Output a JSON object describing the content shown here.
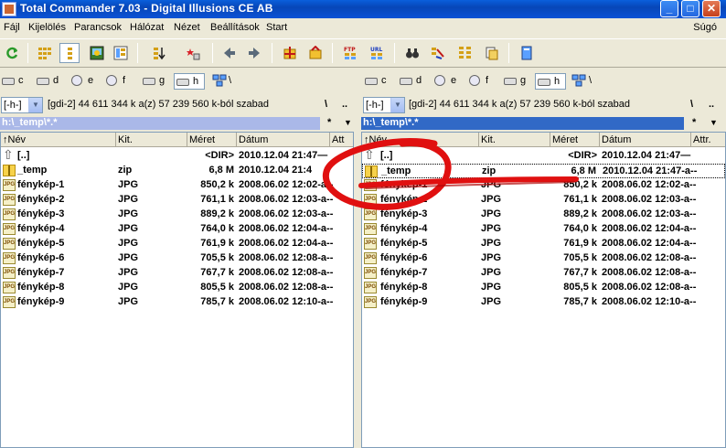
{
  "window": {
    "title": "Total Commander 7.03 - Digital Illusions CE AB",
    "minimize": "_",
    "maximize": "□",
    "close": "✕"
  },
  "menu": {
    "items": [
      "Fájl",
      "Kijelölés",
      "Parancsok",
      "Hálózat",
      "Nézet",
      "Beállítások",
      "Start"
    ],
    "help": "Súgó"
  },
  "toolbar": {
    "buttons": [
      "refresh-icon",
      "icons-view-icon",
      "detail-view-icon",
      "thumbnail-view-icon",
      "tree-view-icon",
      "sort-icon",
      "star-icon",
      "back-icon",
      "forward-icon",
      "pack-icon",
      "unpack-icon",
      "ftp-connect-icon",
      "url-connect-icon",
      "find-icon",
      "rename-icon",
      "sync-icon",
      "compare-icon",
      "notepad-icon"
    ],
    "ftp_label": "FTP",
    "url_label": "URL"
  },
  "drives": [
    "c",
    "d",
    "e",
    "f",
    "g",
    "h"
  ],
  "net_label": "\\",
  "left": {
    "combo": "[-h-]",
    "free": "[gdi-2]  44 611 344 k a(z) 57 239 560 k-ból szabad",
    "root": "\\",
    "dotdot": "..",
    "path": "h:\\_temp\\*.*",
    "star": "*",
    "columns": [
      "↑Név",
      "Kit.",
      "Méret",
      "Dátum",
      "Att"
    ],
    "rows": [
      {
        "name": "[..]",
        "ext": "",
        "size": "<DIR>",
        "date": "2010.12.04 21:47—",
        "icon": "up"
      },
      {
        "name": "_temp",
        "ext": "zip",
        "size": "6,8 M",
        "date": "2010.12.04 21:4",
        "icon": "zip"
      },
      {
        "name": "fénykép-1",
        "ext": "JPG",
        "size": "850,2 k",
        "date": "2008.06.02 12:02-a--",
        "icon": "jpg"
      },
      {
        "name": "fénykép-2",
        "ext": "JPG",
        "size": "761,1 k",
        "date": "2008.06.02 12:03-a--",
        "icon": "jpg"
      },
      {
        "name": "fénykép-3",
        "ext": "JPG",
        "size": "889,2 k",
        "date": "2008.06.02 12:03-a--",
        "icon": "jpg"
      },
      {
        "name": "fénykép-4",
        "ext": "JPG",
        "size": "764,0 k",
        "date": "2008.06.02 12:04-a--",
        "icon": "jpg"
      },
      {
        "name": "fénykép-5",
        "ext": "JPG",
        "size": "761,9 k",
        "date": "2008.06.02 12:04-a--",
        "icon": "jpg"
      },
      {
        "name": "fénykép-6",
        "ext": "JPG",
        "size": "705,5 k",
        "date": "2008.06.02 12:08-a--",
        "icon": "jpg"
      },
      {
        "name": "fénykép-7",
        "ext": "JPG",
        "size": "767,7 k",
        "date": "2008.06.02 12:08-a--",
        "icon": "jpg"
      },
      {
        "name": "fénykép-8",
        "ext": "JPG",
        "size": "805,5 k",
        "date": "2008.06.02 12:08-a--",
        "icon": "jpg"
      },
      {
        "name": "fénykép-9",
        "ext": "JPG",
        "size": "785,7 k",
        "date": "2008.06.02 12:10-a--",
        "icon": "jpg"
      }
    ]
  },
  "right": {
    "combo": "[-h-]",
    "free": "[gdi-2]  44 611 344 k a(z) 57 239 560 k-ból szabad",
    "root": "\\",
    "dotdot": "..",
    "path": "h:\\_temp\\*.*",
    "star": "*",
    "columns": [
      "↑Név",
      "Kit.",
      "Méret",
      "Dátum",
      "Attr."
    ],
    "rows": [
      {
        "name": "[..]",
        "ext": "",
        "size": "<DIR>",
        "date": "2010.12.04 21:47—",
        "icon": "up"
      },
      {
        "name": "_temp",
        "ext": "zip",
        "size": "6,8 M",
        "date": "2010.12.04 21:47-a--",
        "icon": "zip"
      },
      {
        "name": "fénykép-1",
        "ext": "JPG",
        "size": "850,2 k",
        "date": "2008.06.02 12:02-a--",
        "icon": "jpg"
      },
      {
        "name": "fénykép-2",
        "ext": "JPG",
        "size": "761,1 k",
        "date": "2008.06.02 12:03-a--",
        "icon": "jpg"
      },
      {
        "name": "fénykép-3",
        "ext": "JPG",
        "size": "889,2 k",
        "date": "2008.06.02 12:03-a--",
        "icon": "jpg"
      },
      {
        "name": "fénykép-4",
        "ext": "JPG",
        "size": "764,0 k",
        "date": "2008.06.02 12:04-a--",
        "icon": "jpg"
      },
      {
        "name": "fénykép-5",
        "ext": "JPG",
        "size": "761,9 k",
        "date": "2008.06.02 12:04-a--",
        "icon": "jpg"
      },
      {
        "name": "fénykép-6",
        "ext": "JPG",
        "size": "705,5 k",
        "date": "2008.06.02 12:08-a--",
        "icon": "jpg"
      },
      {
        "name": "fénykép-7",
        "ext": "JPG",
        "size": "767,7 k",
        "date": "2008.06.02 12:08-a--",
        "icon": "jpg"
      },
      {
        "name": "fénykép-8",
        "ext": "JPG",
        "size": "805,5 k",
        "date": "2008.06.02 12:08-a--",
        "icon": "jpg"
      },
      {
        "name": "fénykép-9",
        "ext": "JPG",
        "size": "785,7 k",
        "date": "2008.06.02 12:10-a--",
        "icon": "jpg"
      }
    ]
  },
  "colors": {
    "titlebar": "#0a5fdc",
    "path_active": "#3169c6",
    "path_inactive": "#aab8e8",
    "annotation_red": "#e01010"
  }
}
